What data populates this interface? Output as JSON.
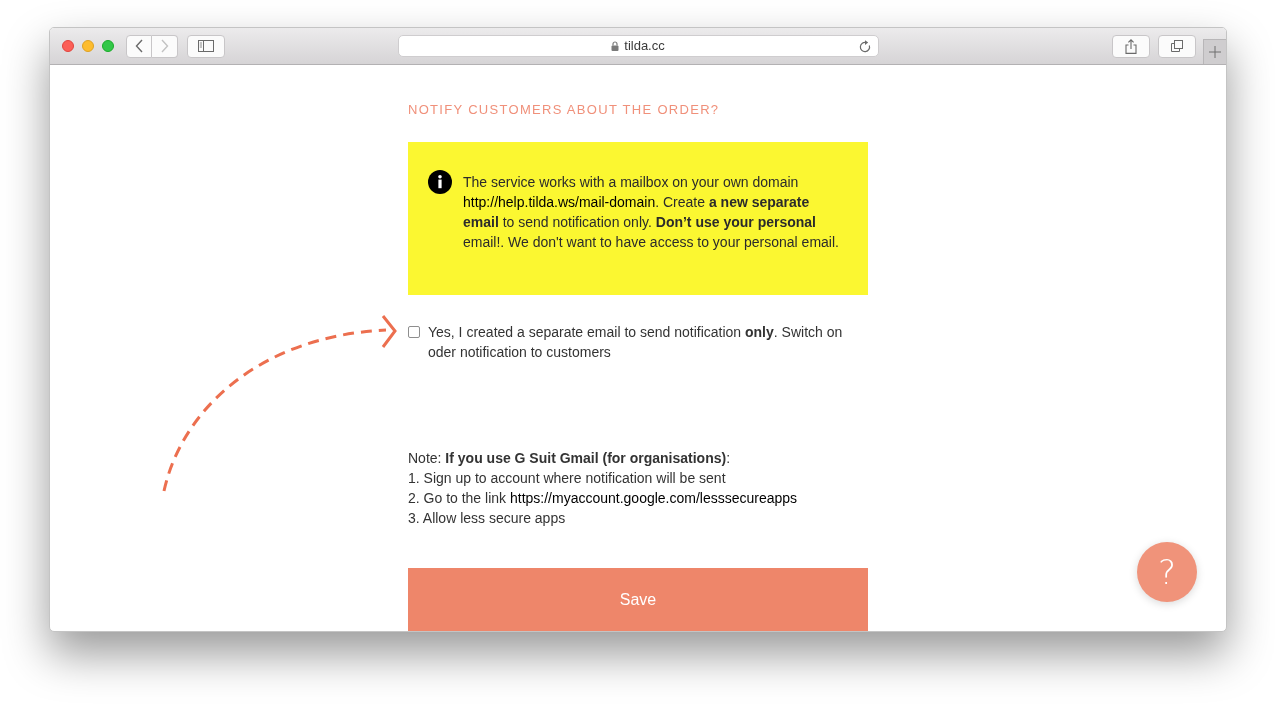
{
  "browser": {
    "back": {
      "disabled": false
    },
    "forward": {
      "disabled": true
    },
    "url": "tilda.cc"
  },
  "heading": "NOTIFY CUSTOMERS ABOUT THE ORDER?",
  "notice": {
    "parts": [
      {
        "kind": "text",
        "text": "The service works with a mailbox on your own domain "
      },
      {
        "kind": "link",
        "text": "http://help.tilda.ws/mail-domain"
      },
      {
        "kind": "text",
        "text": ". Create **a new separate email** to send notification only. **Don’t use your personal** email!. We don't want to have access to your personal email."
      }
    ]
  },
  "consent": {
    "checked": false,
    "label": "Yes, I created a separate email to send notification **only**. Switch on oder notification to customers"
  },
  "note": {
    "title": "Note: **If you use G Suit Gmail (for organisations)**:",
    "steps": [
      {
        "text": "1. Sign up to account where notification will be sent"
      },
      {
        "text": "2. Go to the link ",
        "link": "https://myaccount.google.com/lesssecureapps"
      },
      {
        "text": "3. Allow less secure apps"
      }
    ]
  },
  "save_button": {
    "label": "Save"
  },
  "help_button": {
    "label": "?"
  }
}
